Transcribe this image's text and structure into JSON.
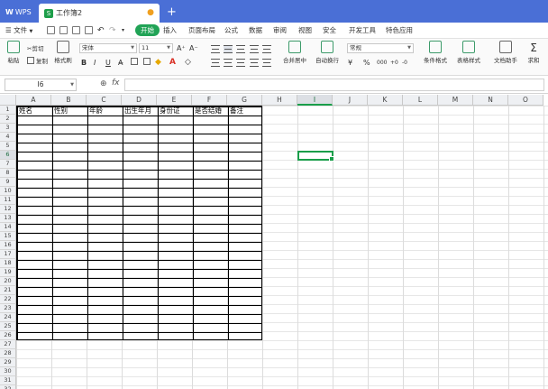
{
  "titlebar": {
    "app_label": "WPS",
    "doc_title": "工作簿2",
    "plus": "+"
  },
  "menu": {
    "file": "文件",
    "tabs": [
      "开始",
      "插入",
      "页面布局",
      "公式",
      "数据",
      "审阅",
      "视图",
      "安全",
      "开发工具",
      "特色应用"
    ],
    "active_tab": "开始"
  },
  "ribbon": {
    "paste": "粘贴",
    "cut": "剪切",
    "copy": "复制",
    "format_painter": "格式刷",
    "font_name": "宋体",
    "font_size": "11",
    "grow_font": "A⁺",
    "shrink_font": "A⁻",
    "bold": "B",
    "italic": "I",
    "underline": "U",
    "merge_center": "合并居中",
    "wrap_text": "自动换行",
    "number_format": "常规",
    "percent": "%",
    "thousands": "000",
    "conditional_format": "条件格式",
    "table_style": "表格样式",
    "doc_assistant": "文档助手",
    "sum": "求和",
    "sum_icon": "Σ"
  },
  "formula": {
    "cell_ref": "I6",
    "fx_label": "fx",
    "value": ""
  },
  "sheet": {
    "columns": [
      "A",
      "B",
      "C",
      "D",
      "E",
      "F",
      "G",
      "H",
      "I",
      "J",
      "K",
      "L",
      "M",
      "N",
      "O"
    ],
    "active_column": "I",
    "active_row": 6,
    "rows": [
      "1",
      "2",
      "3",
      "4",
      "5",
      "6",
      "7",
      "8",
      "9",
      "10",
      "11",
      "12",
      "13",
      "14",
      "15",
      "16",
      "17",
      "18",
      "19",
      "20",
      "21",
      "22",
      "23",
      "24",
      "25",
      "26",
      "27",
      "28",
      "29",
      "30",
      "31",
      "32"
    ],
    "header_cells": [
      "姓名",
      "性别",
      "年龄",
      "出生年月",
      "身份证",
      "是否结婚",
      "备注"
    ]
  },
  "colors": {
    "titlebar": "#4a6fd6",
    "accent_green": "#21a356",
    "selection": "#1a9e4a"
  }
}
